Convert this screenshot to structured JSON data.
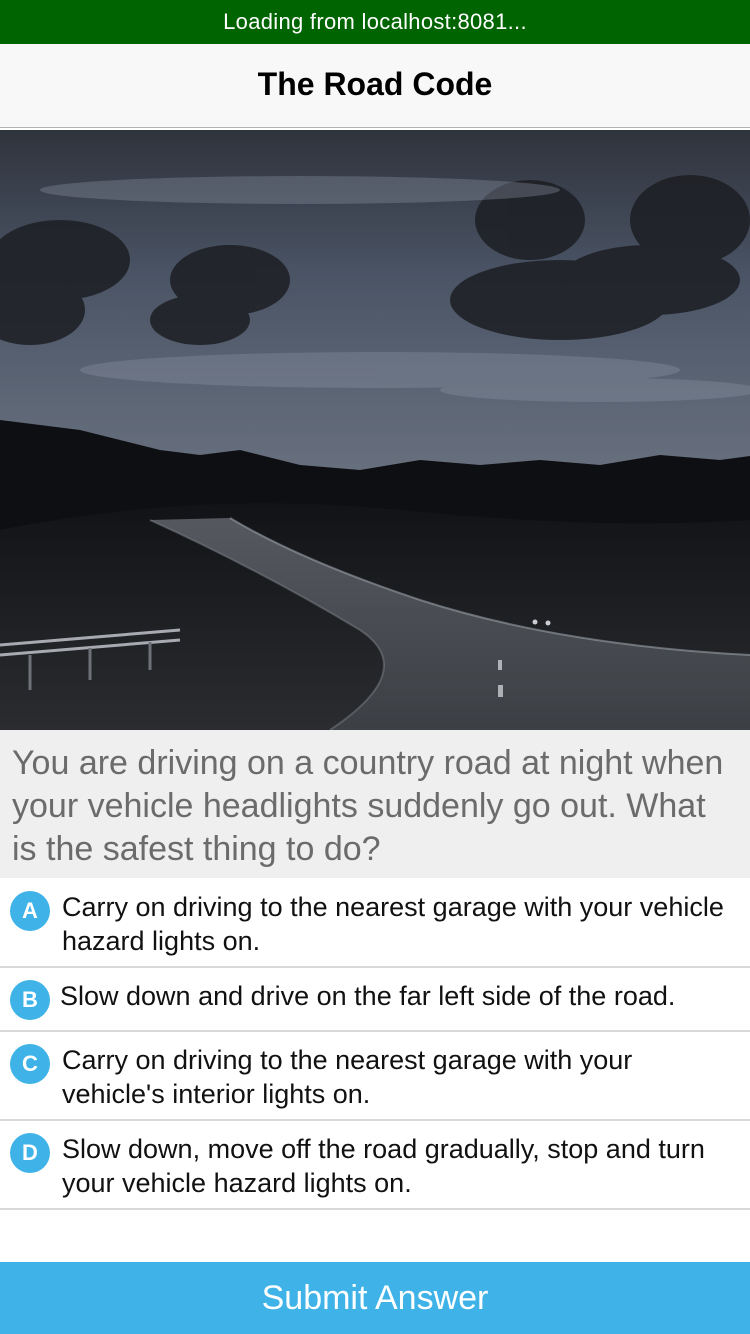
{
  "loading": {
    "text": "Loading from localhost:8081..."
  },
  "nav": {
    "title": "The Road Code"
  },
  "question": {
    "text": "You are driving on a country road at night when your vehicle headlights suddenly go out. What is the safest thing to do?"
  },
  "answers": [
    {
      "letter": "A",
      "text": "Carry on driving to the nearest garage with your vehicle hazard lights on."
    },
    {
      "letter": "B",
      "text": "Slow down and drive on the far left side of the road."
    },
    {
      "letter": "C",
      "text": "Carry on driving to the nearest garage with your vehicle's interior lights on."
    },
    {
      "letter": "D",
      "text": "Slow down, move off the road gradually, stop and turn your vehicle hazard lights on."
    }
  ],
  "submit": {
    "label": "Submit Answer"
  },
  "colors": {
    "loading_bar": "#006400",
    "accent": "#3fb3e8",
    "question_background": "#efefef"
  }
}
